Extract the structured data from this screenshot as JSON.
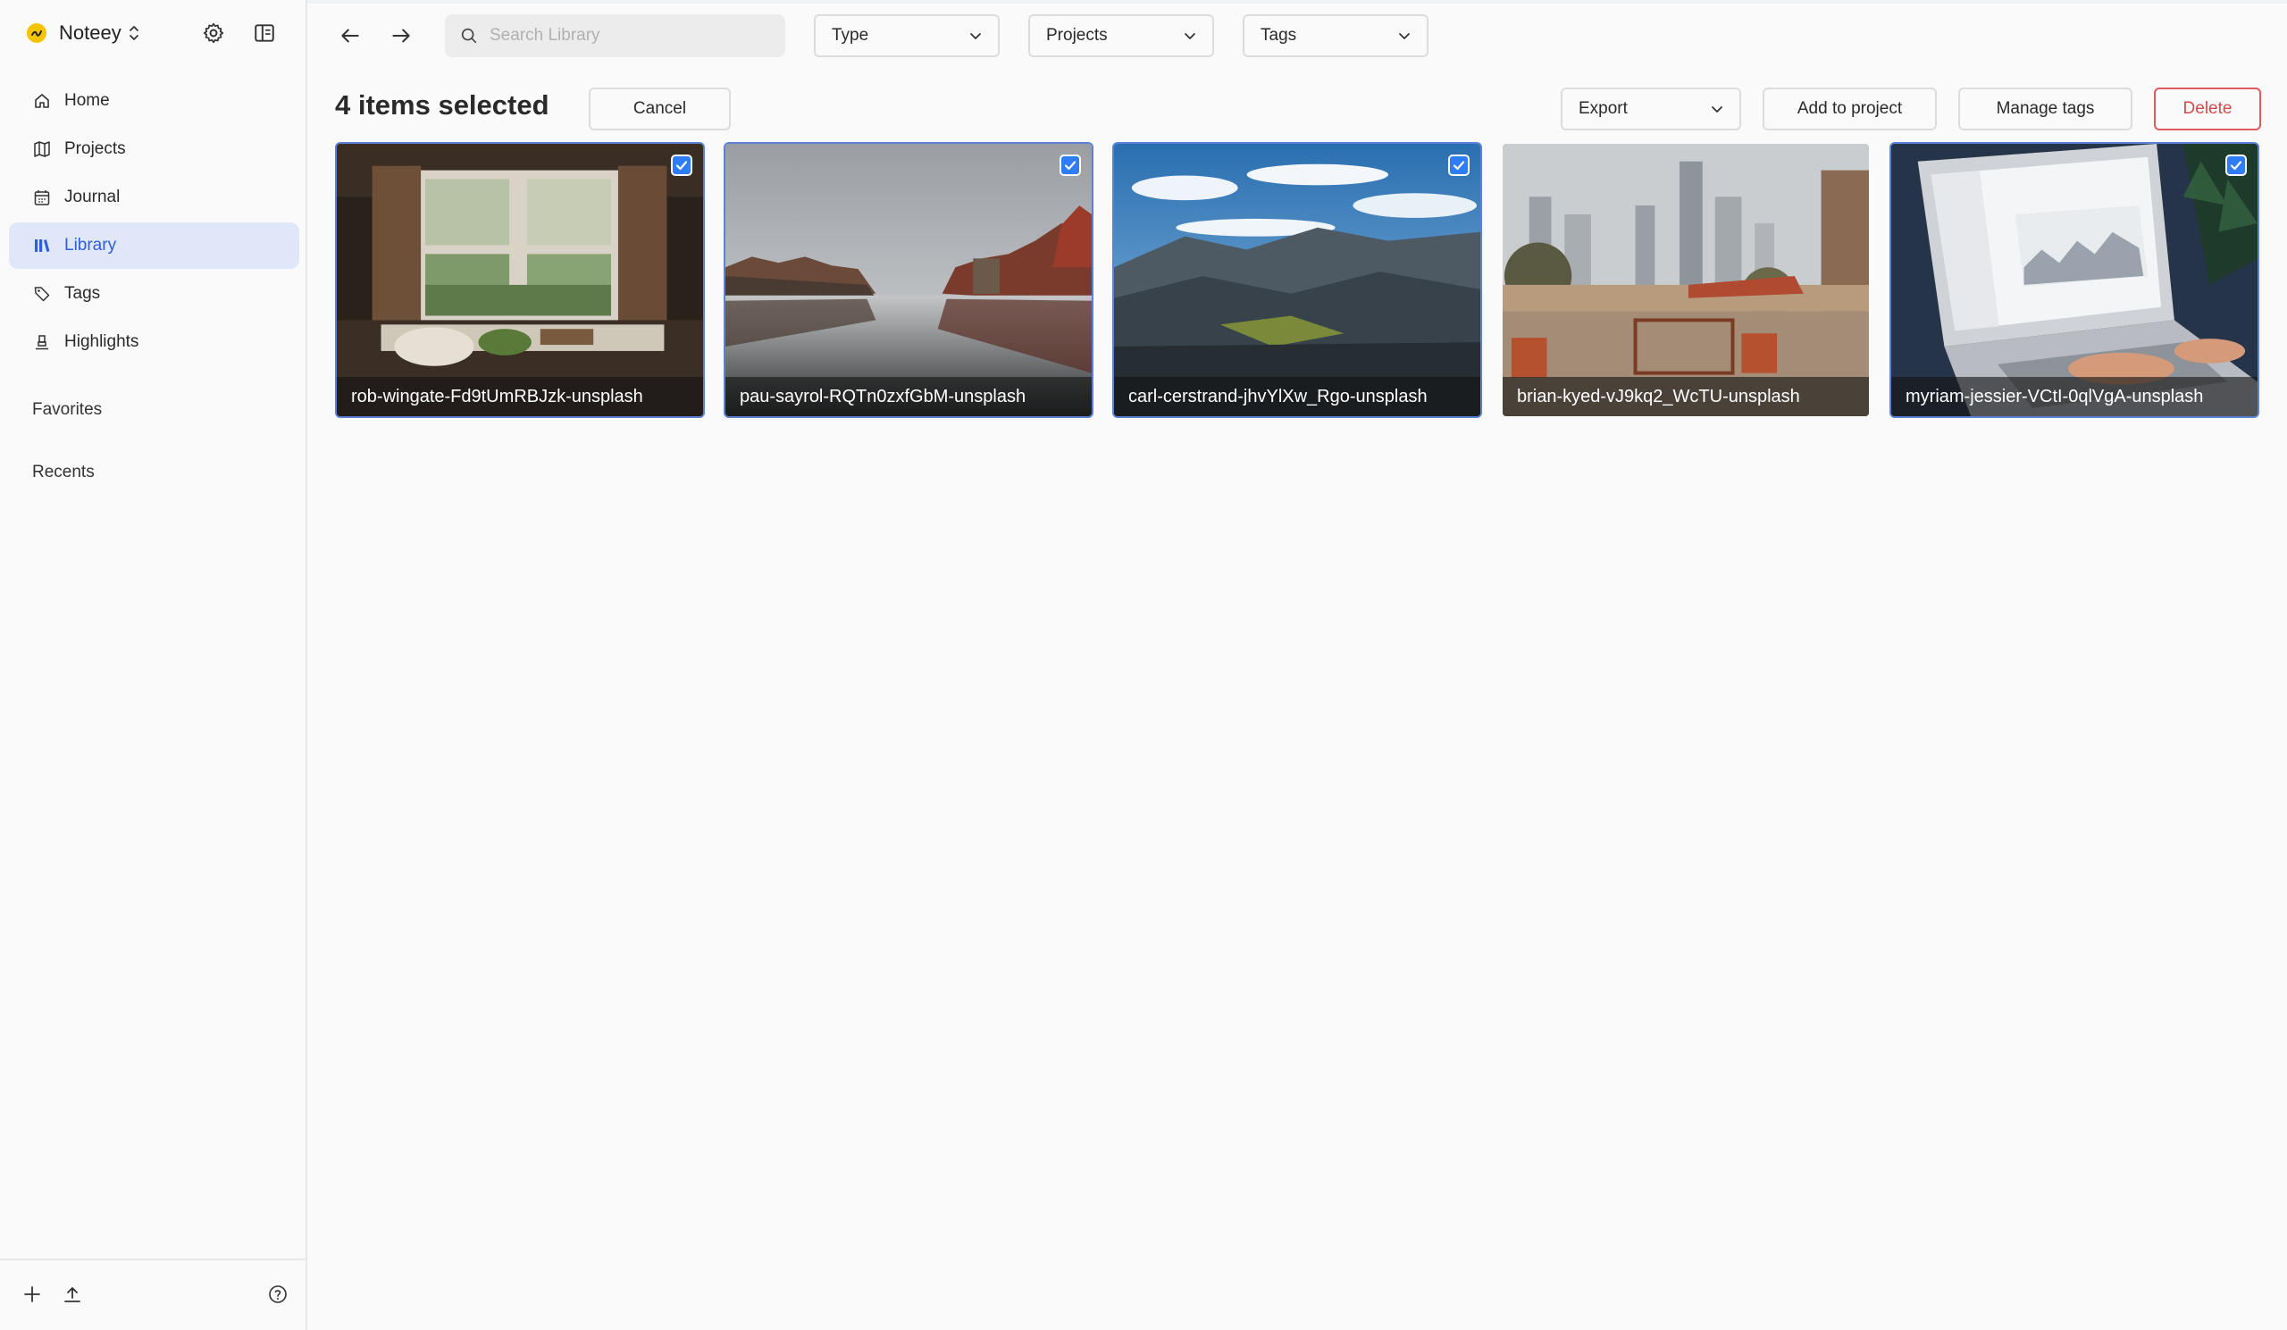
{
  "app": {
    "name": "Noteey"
  },
  "sidebar": {
    "items": [
      {
        "label": "Home",
        "icon": "home-icon"
      },
      {
        "label": "Projects",
        "icon": "map-icon"
      },
      {
        "label": "Journal",
        "icon": "calendar-icon"
      },
      {
        "label": "Library",
        "icon": "library-icon",
        "active": true
      },
      {
        "label": "Tags",
        "icon": "tag-icon"
      },
      {
        "label": "Highlights",
        "icon": "highlighter-icon"
      }
    ],
    "favorites_label": "Favorites",
    "recents_label": "Recents"
  },
  "search": {
    "placeholder": "Search Library"
  },
  "filters": {
    "type": "Type",
    "projects": "Projects",
    "tags": "Tags"
  },
  "selection": {
    "title": "4 items selected",
    "cancel": "Cancel",
    "export": "Export",
    "add_to_project": "Add to project",
    "manage_tags": "Manage tags",
    "delete": "Delete"
  },
  "library": {
    "items": [
      {
        "name": "rob-wingate-Fd9tUmRBJzk-unsplash",
        "checked": true
      },
      {
        "name": "pau-sayrol-RQTn0zxfGbM-unsplash",
        "checked": true
      },
      {
        "name": "carl-cerstrand-jhvYlXw_Rgo-unsplash",
        "checked": true
      },
      {
        "name": "brian-kyed-vJ9kq2_WcTU-unsplash",
        "checked": false
      },
      {
        "name": "myriam-jessier-VCtI-0qlVgA-unsplash",
        "checked": true
      }
    ]
  },
  "colors": {
    "accent": "#2e5fd8",
    "checkbox": "#2f7df6",
    "danger": "#d24b4b",
    "active_nav_bg": "#dfe7f8"
  }
}
